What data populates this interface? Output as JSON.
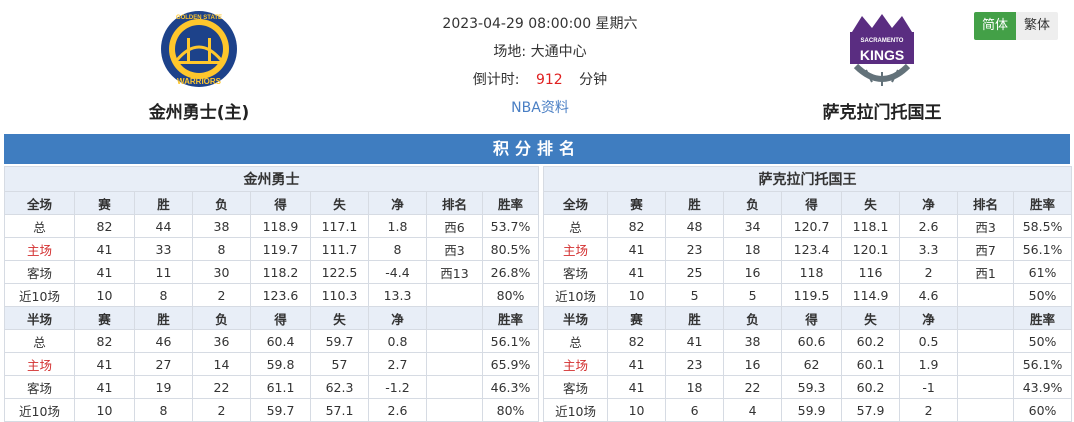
{
  "header": {
    "datetime": "2023-04-29 08:00:00 星期六",
    "venue_label": "场地:",
    "venue": "大通中心",
    "countdown_label": "倒计时:",
    "countdown_value": "912",
    "countdown_unit": "分钟",
    "nba_link": "NBA资料"
  },
  "home_team": {
    "name": "金州勇士(主)",
    "logo_text_top": "GOLDEN STATE",
    "logo_text_bottom": "WARRIORS"
  },
  "away_team": {
    "name": "萨克拉门托国王",
    "logo_text_top": "SACRAMENTO",
    "logo_text_bottom": "KINGS"
  },
  "lang": {
    "simplified": "简体",
    "traditional": "繁体"
  },
  "section_title": "积分排名",
  "colors": {
    "header_blue": "#3f7dc0",
    "highlight_red": "#d32f2f",
    "active_green": "#43a047",
    "accent_red": "#e02020"
  },
  "standings": {
    "left": {
      "team": "金州勇士",
      "full_headers": [
        "全场",
        "赛",
        "胜",
        "负",
        "得",
        "失",
        "净",
        "排名",
        "胜率"
      ],
      "full_rows": [
        [
          "总",
          "82",
          "44",
          "38",
          "118.9",
          "117.1",
          "1.8",
          "西6",
          "53.7%"
        ],
        [
          "主场",
          "41",
          "33",
          "8",
          "119.7",
          "111.7",
          "8",
          "西3",
          "80.5%"
        ],
        [
          "客场",
          "41",
          "11",
          "30",
          "118.2",
          "122.5",
          "-4.4",
          "西13",
          "26.8%"
        ],
        [
          "近10场",
          "10",
          "8",
          "2",
          "123.6",
          "110.3",
          "13.3",
          "",
          "80%"
        ]
      ],
      "half_headers": [
        "半场",
        "赛",
        "胜",
        "负",
        "得",
        "失",
        "净",
        "",
        "胜率"
      ],
      "half_rows": [
        [
          "总",
          "82",
          "46",
          "36",
          "60.4",
          "59.7",
          "0.8",
          "",
          "56.1%"
        ],
        [
          "主场",
          "41",
          "27",
          "14",
          "59.8",
          "57",
          "2.7",
          "",
          "65.9%"
        ],
        [
          "客场",
          "41",
          "19",
          "22",
          "61.1",
          "62.3",
          "-1.2",
          "",
          "46.3%"
        ],
        [
          "近10场",
          "10",
          "8",
          "2",
          "59.7",
          "57.1",
          "2.6",
          "",
          "80%"
        ]
      ]
    },
    "right": {
      "team": "萨克拉门托国王",
      "full_headers": [
        "全场",
        "赛",
        "胜",
        "负",
        "得",
        "失",
        "净",
        "排名",
        "胜率"
      ],
      "full_rows": [
        [
          "总",
          "82",
          "48",
          "34",
          "120.7",
          "118.1",
          "2.6",
          "西3",
          "58.5%"
        ],
        [
          "主场",
          "41",
          "23",
          "18",
          "123.4",
          "120.1",
          "3.3",
          "西7",
          "56.1%"
        ],
        [
          "客场",
          "41",
          "25",
          "16",
          "118",
          "116",
          "2",
          "西1",
          "61%"
        ],
        [
          "近10场",
          "10",
          "5",
          "5",
          "119.5",
          "114.9",
          "4.6",
          "",
          "50%"
        ]
      ],
      "half_headers": [
        "半场",
        "赛",
        "胜",
        "负",
        "得",
        "失",
        "净",
        "",
        "胜率"
      ],
      "half_rows": [
        [
          "总",
          "82",
          "41",
          "38",
          "60.6",
          "60.2",
          "0.5",
          "",
          "50%"
        ],
        [
          "主场",
          "41",
          "23",
          "16",
          "62",
          "60.1",
          "1.9",
          "",
          "56.1%"
        ],
        [
          "客场",
          "41",
          "18",
          "22",
          "59.3",
          "60.2",
          "-1",
          "",
          "43.9%"
        ],
        [
          "近10场",
          "10",
          "6",
          "4",
          "59.9",
          "57.9",
          "2",
          "",
          "60%"
        ]
      ]
    }
  }
}
